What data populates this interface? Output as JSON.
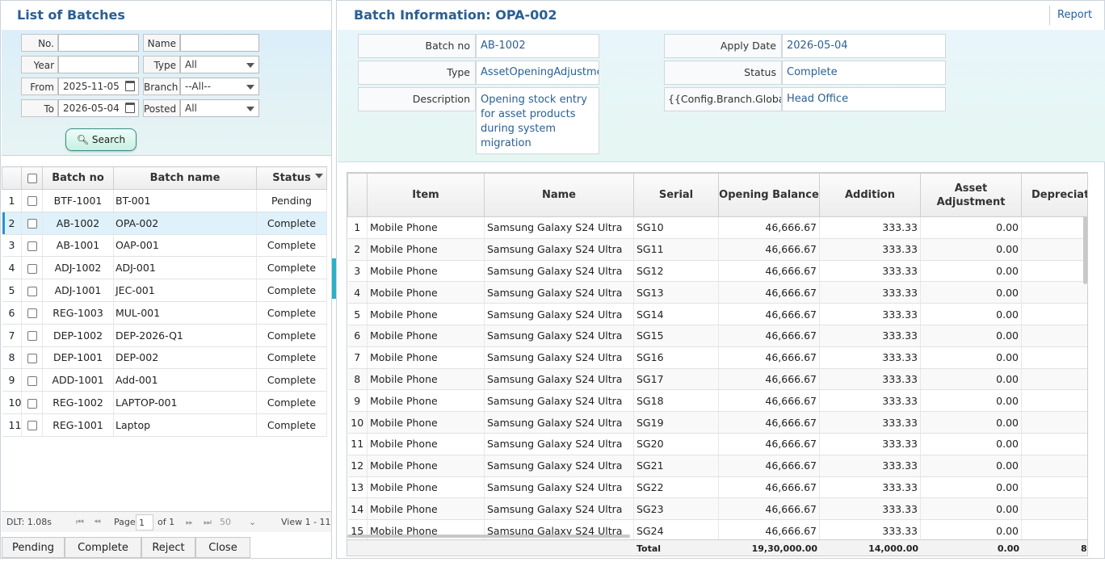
{
  "left_panel": {
    "title": "List of Batches",
    "filters": {
      "no_label": "No.",
      "no_value": "",
      "name_label": "Name",
      "name_value": "",
      "year_label": "Year",
      "year_value": "",
      "type_label": "Type",
      "type_value": "All",
      "from_label": "From",
      "from_value": "2025-11-05",
      "branch_label": "Branch",
      "branch_value": "--All--",
      "to_label": "To",
      "to_value": "2026-05-04",
      "posted_label": "Posted",
      "posted_value": "All",
      "search_label": "Search"
    },
    "table": {
      "columns": [
        "Batch no",
        "Batch name",
        "Status"
      ],
      "rows": [
        {
          "n": "1",
          "no": "BTF-1001",
          "name": "BT-001",
          "status": "Pending"
        },
        {
          "n": "2",
          "no": "AB-1002",
          "name": "OPA-002",
          "status": "Complete"
        },
        {
          "n": "3",
          "no": "AB-1001",
          "name": "OAP-001",
          "status": "Complete"
        },
        {
          "n": "4",
          "no": "ADJ-1002",
          "name": "ADJ-001",
          "status": "Complete"
        },
        {
          "n": "5",
          "no": "ADJ-1001",
          "name": "JEC-001",
          "status": "Complete"
        },
        {
          "n": "6",
          "no": "REG-1003",
          "name": "MUL-001",
          "status": "Complete"
        },
        {
          "n": "7",
          "no": "DEP-1002",
          "name": "DEP-2026-Q1",
          "status": "Complete"
        },
        {
          "n": "8",
          "no": "DEP-1001",
          "name": "DEP-002",
          "status": "Complete"
        },
        {
          "n": "9",
          "no": "ADD-1001",
          "name": "Add-001",
          "status": "Complete"
        },
        {
          "n": "10",
          "no": "REG-1002",
          "name": "LAPTOP-001",
          "status": "Complete"
        },
        {
          "n": "11",
          "no": "REG-1001",
          "name": "Laptop",
          "status": "Complete"
        }
      ],
      "selected_row": 2
    },
    "pager": {
      "dlt": "DLT: 1.08s",
      "page_label": "Page",
      "page_value": "1",
      "of_label": "of 1",
      "page_size": "50",
      "view": "View 1 - 11"
    },
    "buttons": [
      "Pending",
      "Complete",
      "Reject",
      "Close"
    ]
  },
  "right_panel": {
    "title": "Batch Information: OPA-002",
    "report_label": "Report",
    "fields": {
      "batch_no_label": "Batch no",
      "batch_no_value": "AB-1002",
      "type_label": "Type",
      "type_value": "AssetOpeningAdjustment",
      "description_label": "Description",
      "description_value": "Opening stock entry for asset products during system migration",
      "apply_date_label": "Apply Date",
      "apply_date_value": "2026-05-04",
      "status_label": "Status",
      "status_value": "Complete",
      "branch_label": "{{Config.Branch.GlobalN",
      "branch_value": "Head Office"
    },
    "grid": {
      "columns": [
        "Item",
        "Name",
        "Serial",
        "Opening Balance",
        "Addition",
        "Asset Adjustment",
        "Depreciat"
      ],
      "rows": [
        {
          "n": "1",
          "item": "Mobile Phone",
          "name": "Samsung Galaxy S24 Ultra",
          "serial": "SG10",
          "opening": "46,666.67",
          "addition": "333.33",
          "adj": "0.00"
        },
        {
          "n": "2",
          "item": "Mobile Phone",
          "name": "Samsung Galaxy S24 Ultra",
          "serial": "SG11",
          "opening": "46,666.67",
          "addition": "333.33",
          "adj": "0.00"
        },
        {
          "n": "3",
          "item": "Mobile Phone",
          "name": "Samsung Galaxy S24 Ultra",
          "serial": "SG12",
          "opening": "46,666.67",
          "addition": "333.33",
          "adj": "0.00"
        },
        {
          "n": "4",
          "item": "Mobile Phone",
          "name": "Samsung Galaxy S24 Ultra",
          "serial": "SG13",
          "opening": "46,666.67",
          "addition": "333.33",
          "adj": "0.00"
        },
        {
          "n": "5",
          "item": "Mobile Phone",
          "name": "Samsung Galaxy S24 Ultra",
          "serial": "SG14",
          "opening": "46,666.67",
          "addition": "333.33",
          "adj": "0.00"
        },
        {
          "n": "6",
          "item": "Mobile Phone",
          "name": "Samsung Galaxy S24 Ultra",
          "serial": "SG15",
          "opening": "46,666.67",
          "addition": "333.33",
          "adj": "0.00"
        },
        {
          "n": "7",
          "item": "Mobile Phone",
          "name": "Samsung Galaxy S24 Ultra",
          "serial": "SG16",
          "opening": "46,666.67",
          "addition": "333.33",
          "adj": "0.00"
        },
        {
          "n": "8",
          "item": "Mobile Phone",
          "name": "Samsung Galaxy S24 Ultra",
          "serial": "SG17",
          "opening": "46,666.67",
          "addition": "333.33",
          "adj": "0.00"
        },
        {
          "n": "9",
          "item": "Mobile Phone",
          "name": "Samsung Galaxy S24 Ultra",
          "serial": "SG18",
          "opening": "46,666.67",
          "addition": "333.33",
          "adj": "0.00"
        },
        {
          "n": "10",
          "item": "Mobile Phone",
          "name": "Samsung Galaxy S24 Ultra",
          "serial": "SG19",
          "opening": "46,666.67",
          "addition": "333.33",
          "adj": "0.00"
        },
        {
          "n": "11",
          "item": "Mobile Phone",
          "name": "Samsung Galaxy S24 Ultra",
          "serial": "SG20",
          "opening": "46,666.67",
          "addition": "333.33",
          "adj": "0.00"
        },
        {
          "n": "12",
          "item": "Mobile Phone",
          "name": "Samsung Galaxy S24 Ultra",
          "serial": "SG21",
          "opening": "46,666.67",
          "addition": "333.33",
          "adj": "0.00"
        },
        {
          "n": "13",
          "item": "Mobile Phone",
          "name": "Samsung Galaxy S24 Ultra",
          "serial": "SG22",
          "opening": "46,666.67",
          "addition": "333.33",
          "adj": "0.00"
        },
        {
          "n": "14",
          "item": "Mobile Phone",
          "name": "Samsung Galaxy S24 Ultra",
          "serial": "SG23",
          "opening": "46,666.67",
          "addition": "333.33",
          "adj": "0.00"
        },
        {
          "n": "15",
          "item": "Mobile Phone",
          "name": "Samsung Galaxy S24 Ultra",
          "serial": "SG24",
          "opening": "46,666.67",
          "addition": "333.33",
          "adj": "0.00"
        }
      ],
      "footer": {
        "label": "Total",
        "opening": "19,30,000.00",
        "addition": "14,000.00",
        "adj": "0.00",
        "dep": "8"
      }
    }
  },
  "colors": {
    "accent": "#2a5f94",
    "selected_row": "#dff1fa",
    "splitter": "#2bb0c8"
  }
}
